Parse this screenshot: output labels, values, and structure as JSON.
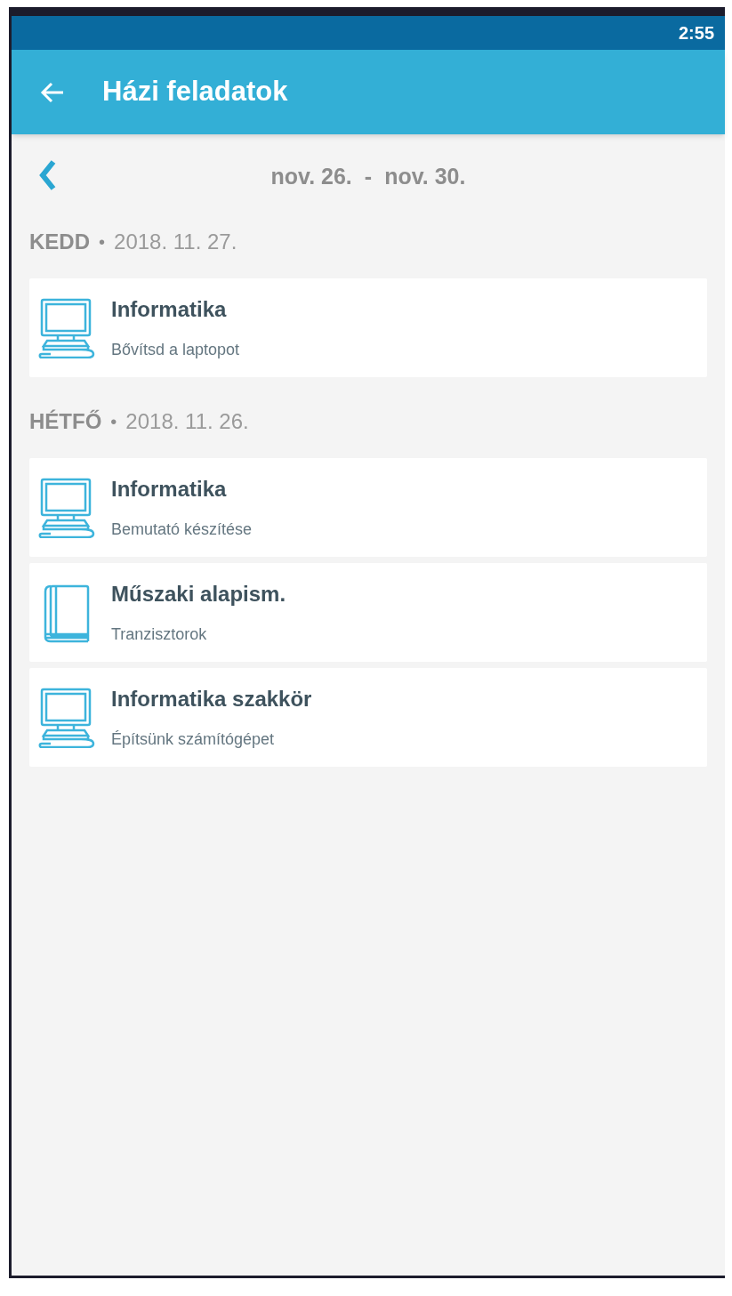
{
  "status_bar": {
    "time": "2:55"
  },
  "app_bar": {
    "title": "Házi feladatok"
  },
  "week_nav": {
    "range_start": "nov. 26.",
    "separator": "-",
    "range_end": "nov. 30."
  },
  "days": [
    {
      "day": "KEDD",
      "separator": "•",
      "date": "2018. 11. 27.",
      "items": [
        {
          "kind": "computer",
          "subject": "Informatika",
          "task": "Bővítsd a laptopot"
        }
      ]
    },
    {
      "day": "HÉTFŐ",
      "separator": "•",
      "date": "2018. 11. 26.",
      "items": [
        {
          "kind": "computer",
          "subject": "Informatika",
          "task": "Bemutató készítése"
        },
        {
          "kind": "book",
          "subject": "Műszaki alapism.",
          "task": "Tranzisztorok"
        },
        {
          "kind": "computer",
          "subject": "Informatika szakkör",
          "task": "Építsünk számítógépet"
        }
      ]
    }
  ]
}
